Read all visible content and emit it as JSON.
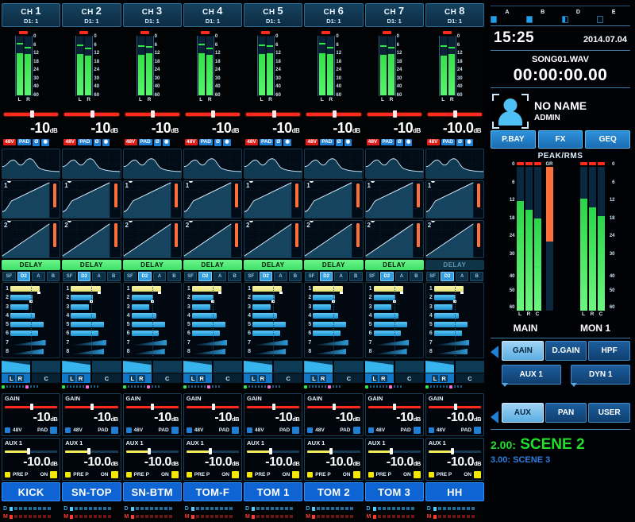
{
  "channels": [
    {
      "num": "1",
      "sub": "D1: 1",
      "name": "KICK",
      "gain": "-10",
      "gain_unit": "dB",
      "delay": "DELAY",
      "delay_on": true,
      "meter_l": 72,
      "meter_r": 70,
      "aux_label": "AUX 1",
      "aux_val": "-10.0",
      "aux_unit": "dB",
      "gain_knob": 48,
      "aux_knob": 42,
      "pad_on": true
    },
    {
      "num": "2",
      "sub": "D1: 1",
      "name": "SN-TOP",
      "gain": "-10",
      "gain_unit": "dB",
      "delay": "DELAY",
      "delay_on": true,
      "meter_l": 70,
      "meter_r": 68,
      "aux_label": "AUX 1",
      "aux_val": "-10.0",
      "aux_unit": "dB",
      "gain_knob": 48,
      "aux_knob": 42,
      "pad_on": true
    },
    {
      "num": "3",
      "sub": "D1: 1",
      "name": "SN-BTM",
      "gain": "-10",
      "gain_unit": "dB",
      "delay": "DELAY",
      "delay_on": true,
      "meter_l": 69,
      "meter_r": 71,
      "aux_label": "AUX 1",
      "aux_val": "-10.0",
      "aux_unit": "dB",
      "gain_knob": 48,
      "aux_knob": 42,
      "pad_on": true
    },
    {
      "num": "4",
      "sub": "D1: 1",
      "name": "TOM-F",
      "gain": "-10",
      "gain_unit": "dB",
      "delay": "DELAY",
      "delay_on": true,
      "meter_l": 71,
      "meter_r": 69,
      "aux_label": "AUX 1",
      "aux_val": "-10.0",
      "aux_unit": "dB",
      "gain_knob": 48,
      "aux_knob": 42,
      "pad_on": true
    },
    {
      "num": "5",
      "sub": "D1: 1",
      "name": "TOM 1",
      "gain": "-10",
      "gain_unit": "dB",
      "delay": "DELAY",
      "delay_on": true,
      "meter_l": 70,
      "meter_r": 72,
      "aux_label": "AUX 1",
      "aux_val": "-10.0",
      "aux_unit": "dB",
      "gain_knob": 48,
      "aux_knob": 42,
      "pad_on": true
    },
    {
      "num": "6",
      "sub": "D1: 1",
      "name": "TOM 2",
      "gain": "-10",
      "gain_unit": "dB",
      "delay": "DELAY",
      "delay_on": true,
      "meter_l": 72,
      "meter_r": 70,
      "aux_label": "AUX 1",
      "aux_val": "-10.0",
      "aux_unit": "dB",
      "gain_knob": 48,
      "aux_knob": 42,
      "pad_on": true
    },
    {
      "num": "7",
      "sub": "D1: 1",
      "name": "TOM 3",
      "gain": "-10",
      "gain_unit": "dB",
      "delay": "DELAY",
      "delay_on": true,
      "meter_l": 69,
      "meter_r": 70,
      "aux_label": "AUX 1",
      "aux_val": "-10.0",
      "aux_unit": "dB",
      "gain_knob": 48,
      "aux_knob": 42,
      "pad_on": true
    },
    {
      "num": "8",
      "sub": "D1: 1",
      "name": "HH",
      "gain": "-10.0",
      "gain_unit": "dB",
      "delay": "DELAY",
      "delay_on": false,
      "meter_l": 68,
      "meter_r": 70,
      "aux_label": "AUX 1",
      "aux_val": "-10.0",
      "aux_unit": "dB",
      "gain_knob": 48,
      "aux_knob": 42,
      "pad_on": true
    }
  ],
  "strip_common": {
    "meter_scale": [
      "0",
      "6",
      "12",
      "18",
      "24",
      "30",
      "40",
      "60"
    ],
    "lr_labels": [
      "L",
      "R"
    ],
    "pills": {
      "phantom": "48V",
      "pad": "PAD"
    },
    "sends_buttons": [
      "SF",
      "D2",
      "A",
      "B"
    ],
    "sends_active_index": 1,
    "aux_numbers": [
      "1",
      "2",
      "3",
      "4",
      "5",
      "6",
      "7",
      "8"
    ],
    "aux_levels": [
      62,
      46,
      38,
      52,
      70,
      58,
      74,
      70
    ],
    "pan_labels": {
      "lr": "L R",
      "c": "C"
    },
    "gain_caption": "GAIN",
    "phantom_caption": "48V",
    "pad_caption": "PAD",
    "pre_caption": "PRE P",
    "on_caption": "ON",
    "dm_labels": {
      "d": "D",
      "m": "M"
    },
    "dyn_nums": [
      "1",
      "2"
    ]
  },
  "right": {
    "abde": {
      "labels": [
        "A",
        "B",
        "D",
        "E"
      ],
      "fills": [
        100,
        100,
        55,
        0
      ]
    },
    "clock": {
      "time": "15:25",
      "date": "2014.07.04"
    },
    "recorder": {
      "file": "SONG01.WAV",
      "timecode": "00:00:00.00"
    },
    "user": {
      "name": "NO NAME",
      "role": "ADMIN"
    },
    "top_buttons": [
      "P.BAY",
      "FX",
      "GEQ"
    ],
    "meters": {
      "title": "PEAK/RMS",
      "scale": [
        "0",
        "6",
        "12",
        "18",
        "24",
        "30",
        "40",
        "50",
        "60"
      ],
      "gr_label": "GR",
      "group_labels": [
        "L",
        "R",
        "C"
      ],
      "main_values": [
        76,
        70,
        64
      ],
      "main_peaks": [
        54,
        44,
        30
      ],
      "mon_values": [
        78,
        72,
        66
      ],
      "mon_peaks": [
        52,
        42,
        42
      ],
      "gr_value": 52
    },
    "bus_labels": [
      "MAIN",
      "MON 1"
    ],
    "ctl_row1": [
      "GAIN",
      "D.GAIN",
      "HPF"
    ],
    "ctl_row1_selected": 0,
    "ctl_row2": [
      "AUX 1",
      "DYN 1"
    ],
    "ctl_row3": [
      "AUX",
      "PAN",
      "USER"
    ],
    "ctl_row3_selected": 0,
    "scene_current": "2.00:",
    "scene_current_name": "SCENE 2",
    "scene_next": "3.00: SCENE 3"
  }
}
